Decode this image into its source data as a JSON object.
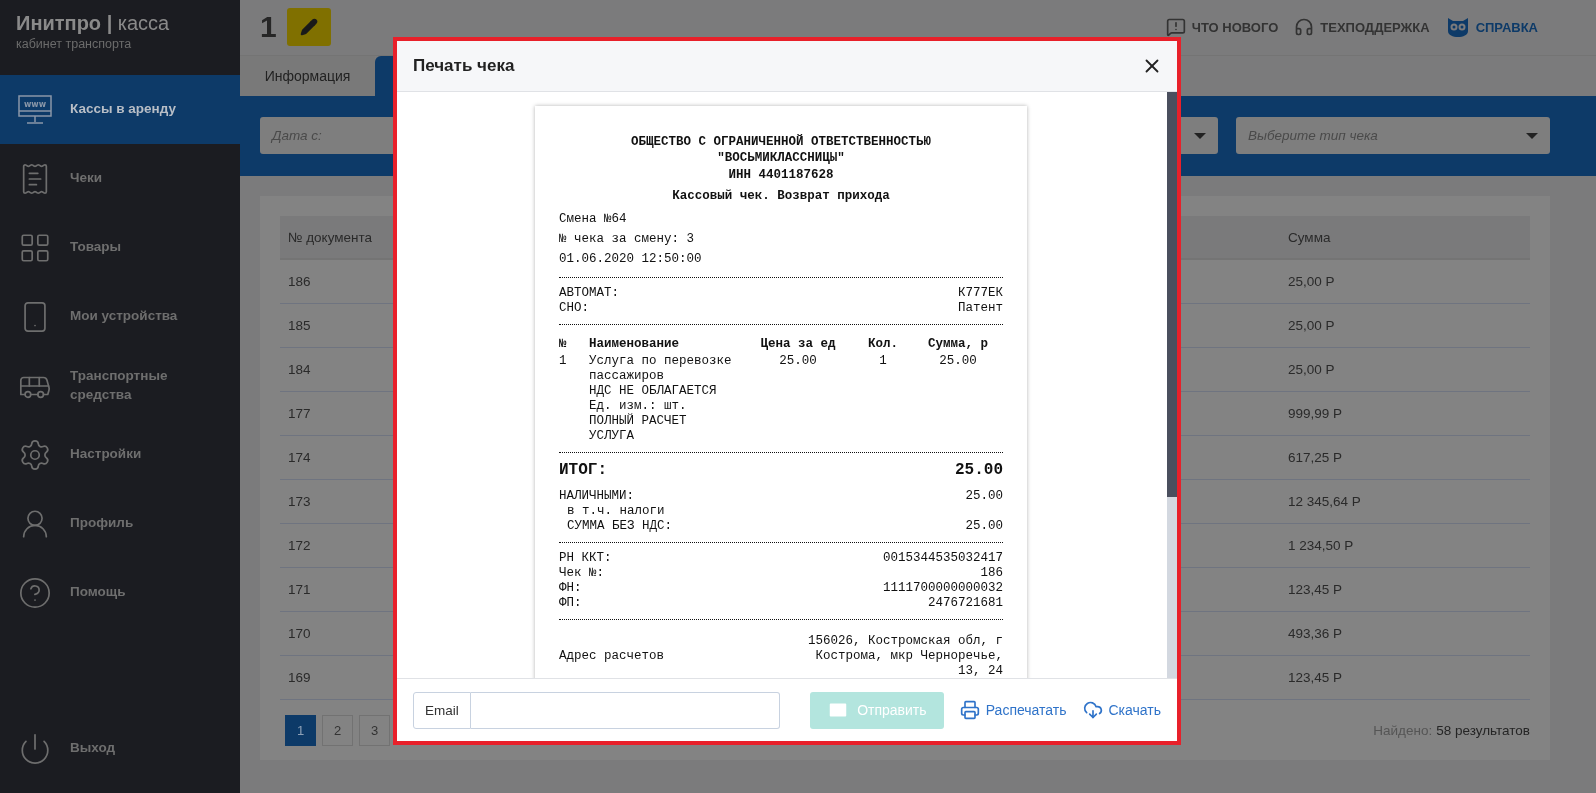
{
  "sidebar": {
    "brand": "Инитпро",
    "brand_separator": "|",
    "brand_suffix": "касса",
    "subtitle": "кабинет транспорта",
    "items": [
      {
        "label": "Кассы в аренду",
        "kind": "www",
        "selected": true
      },
      {
        "label": "Чеки",
        "kind": "receipt",
        "selected": false
      },
      {
        "label": "Товары",
        "kind": "grid",
        "selected": false
      },
      {
        "label": "Мои устройства",
        "kind": "phone",
        "selected": false
      },
      {
        "label": "Транспортные средства",
        "kind": "bus",
        "selected": false
      },
      {
        "label": "Настройки",
        "kind": "settings",
        "selected": false
      },
      {
        "label": "Профиль",
        "kind": "profile",
        "selected": false
      },
      {
        "label": "Помощь",
        "kind": "help",
        "selected": false
      }
    ],
    "exit": {
      "label": "Выход"
    }
  },
  "header": {
    "title": "1",
    "links": [
      {
        "label": "ЧТО НОВОГО",
        "kind": "news"
      },
      {
        "label": "ТЕХПОДДЕРЖКА",
        "kind": "support"
      },
      {
        "label": "СПРАВКА",
        "kind": "help"
      }
    ]
  },
  "tabs": [
    {
      "label": "Информация",
      "selected": false
    },
    {
      "selected": true
    }
  ],
  "filters": {
    "date_from": {
      "placeholder": "Дата с:"
    },
    "type_select": {
      "placeholder": "Выберите тип чека"
    }
  },
  "table": {
    "columns": [
      "№ документа",
      "Сумма"
    ],
    "rows": [
      {
        "document": "186",
        "sum": "25,00 Р"
      },
      {
        "document": "185",
        "sum": "25,00 Р"
      },
      {
        "document": "184",
        "sum": "25,00 Р"
      },
      {
        "document": "177",
        "sum": "999,99 Р"
      },
      {
        "document": "174",
        "sum": "617,25 Р"
      },
      {
        "document": "173",
        "sum": "12 345,64 Р"
      },
      {
        "document": "172",
        "sum": "1 234,50 Р"
      },
      {
        "document": "171",
        "sum": "123,45 Р"
      },
      {
        "document": "170",
        "sum": "493,36 Р"
      },
      {
        "document": "169",
        "sum": "123,45 Р"
      }
    ]
  },
  "pagination": {
    "pages": [
      {
        "label": "1",
        "selected": true
      },
      {
        "label": "2",
        "selected": false
      },
      {
        "label": "3",
        "selected": false
      }
    ]
  },
  "results": {
    "label": "Найдено:",
    "value": "58 результатов"
  },
  "modal": {
    "title": "Печать чека",
    "receipt": {
      "org_lines": [
        "ОБЩЕСТВО С ОГРАНИЧЕННОЙ ОТВЕТСТВЕННОСТЬЮ",
        "\"ВОСЬМИКЛАССНИЦЫ\"",
        "ИНН 4401187628"
      ],
      "title": "Кассовый чек. Возврат прихода",
      "info_lines": [
        "Смена №64",
        "№ чека за смену: 3",
        "01.06.2020 12:50:00"
      ],
      "sections": [
        {
          "kind": "pairs",
          "rows": [
            {
              "label": "АВТОМАТ:",
              "value": "К777ЕК"
            },
            {
              "label": "СНО:",
              "value": "Патент"
            }
          ]
        },
        {
          "kind": "items",
          "columns": [
            "№",
            "Наименование",
            "Цена за ед",
            "Кол.",
            "Сумма, р"
          ],
          "rows": [
            {
              "number": "1",
              "lines": [
                "Услуга по перевозке пассажиров",
                "НДС НЕ ОБЛАГАЕТСЯ",
                "Ед. изм.: шт.",
                "ПОЛНЫЙ РАСЧЕТ",
                "УСЛУГА"
              ],
              "price": "25.00",
              "quantity": "1",
              "sum": "25.00"
            }
          ]
        },
        {
          "kind": "total",
          "label": "ИТОГ:",
          "value": "25.00",
          "rows": [
            {
              "label": "НАЛИЧНЫМИ:",
              "value": "25.00",
              "indent": false
            },
            {
              "label": "в т.ч. налоги",
              "indent": true
            },
            {
              "label": "СУММА БЕЗ НДС:",
              "value": "25.00",
              "indent": true
            }
          ]
        },
        {
          "kind": "pairs",
          "rows": [
            {
              "label": "РН ККТ:",
              "value": "0015344535032417"
            },
            {
              "label": "Чек №:",
              "value": "186"
            },
            {
              "label": "ФН:",
              "value": "1111700000000032"
            },
            {
              "label": "ФП:",
              "value": "2476721681"
            }
          ]
        },
        {
          "kind": "address",
          "label": "Адрес расчетов",
          "value": "156026, Костромская обл, г Кострома, мкр Черноречье, 13, 24"
        }
      ]
    },
    "email": {
      "label": "Email"
    },
    "send_button": {
      "label": "Отправить",
      "disabled": true
    },
    "actions": [
      {
        "label": "Распечатать",
        "kind": "print"
      },
      {
        "label": "Скачать",
        "kind": "download"
      }
    ]
  }
}
